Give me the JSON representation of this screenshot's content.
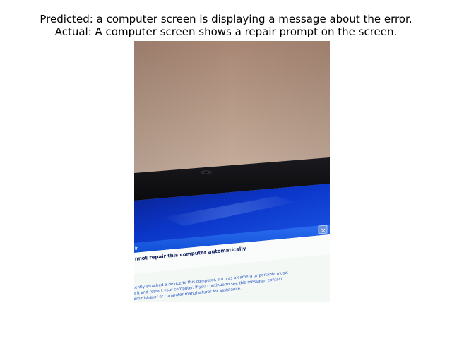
{
  "caption": {
    "predicted": "Predicted: a computer screen is displaying a message about the error.",
    "actual": "Actual: A computer screen shows a repair prompt on the screen."
  },
  "photo": {
    "dialog_title": "ir",
    "dialog_heading": "nnot repair this computer automatically",
    "dialog_body": [
      "cently attached a device to this computer, such as a camera or portable music",
      "e it and restart your computer. If you continue to see this message, contact",
      "dministrator or computer manufacturer for assistance."
    ],
    "close_glyph": "×"
  }
}
